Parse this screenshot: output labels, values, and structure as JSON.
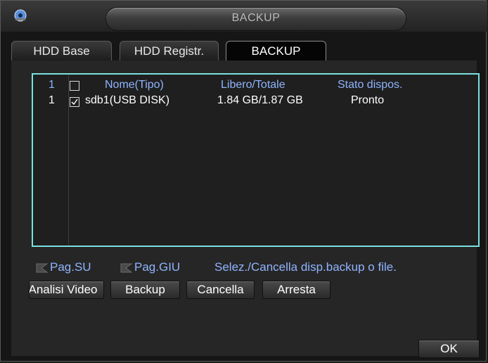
{
  "window": {
    "title": "BACKUP",
    "icon": "app-icon"
  },
  "tabs": [
    {
      "label": "HDD Base",
      "active": false
    },
    {
      "label": "HDD Registr.",
      "active": false
    },
    {
      "label": "BACKUP",
      "active": true
    }
  ],
  "table": {
    "header": {
      "index": "1",
      "checked": false,
      "name": "Nome(Tipo)",
      "space": "Libero/Totale",
      "status": "Stato dispos."
    },
    "rows": [
      {
        "index": "1",
        "checked": true,
        "name": "sdb1(USB DISK)",
        "space": "1.84 GB/1.87 GB",
        "status": "Pronto"
      }
    ]
  },
  "nav": {
    "page_up": "Pag.SU",
    "page_down": "Pag.GIU",
    "hint": "Selez./Cancella disp.backup o file."
  },
  "buttons": {
    "analyze": "Analisi Video",
    "backup": "Backup",
    "cancel": "Cancella",
    "stop": "Arresta",
    "ok": "OK"
  },
  "colors": {
    "accent_text": "#8fb4ff",
    "table_border": "#7be0e0"
  }
}
